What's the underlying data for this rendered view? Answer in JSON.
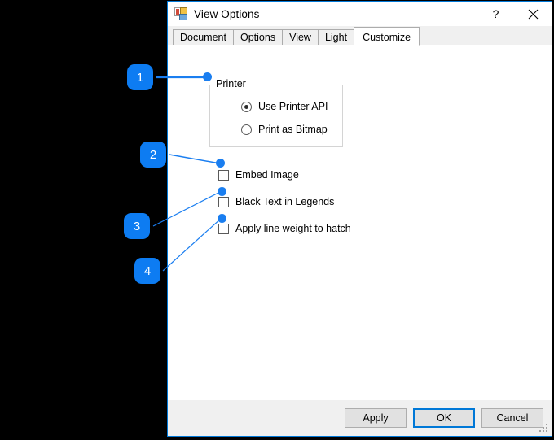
{
  "window": {
    "title": "View Options",
    "icon": "app-window-icon",
    "help_label": "?",
    "close_label": "✕"
  },
  "tabs": [
    {
      "label": "Document",
      "selected": false
    },
    {
      "label": "Options",
      "selected": false
    },
    {
      "label": "View",
      "selected": false
    },
    {
      "label": "Light",
      "selected": false
    },
    {
      "label": "Customize",
      "selected": true
    }
  ],
  "customize": {
    "printer_group": {
      "legend": "Printer",
      "options": [
        {
          "label": "Use Printer API",
          "checked": true
        },
        {
          "label": "Print as Bitmap",
          "checked": false
        }
      ]
    },
    "checkboxes": [
      {
        "label": "Embed Image",
        "checked": false
      },
      {
        "label": "Black Text in Legends",
        "checked": false
      },
      {
        "label": "Apply line weight to hatch",
        "checked": false
      }
    ]
  },
  "footer": {
    "apply_label": "Apply",
    "ok_label": "OK",
    "cancel_label": "Cancel"
  },
  "annotations": {
    "accent_color": "#0d7cf2",
    "markers": [
      {
        "number": "1",
        "target": "printer-group-legend"
      },
      {
        "number": "2",
        "target": "embed-image-checkbox"
      },
      {
        "number": "3",
        "target": "black-text-in-legends-checkbox"
      },
      {
        "number": "4",
        "target": "apply-line-weight-to-hatch-checkbox"
      }
    ]
  }
}
